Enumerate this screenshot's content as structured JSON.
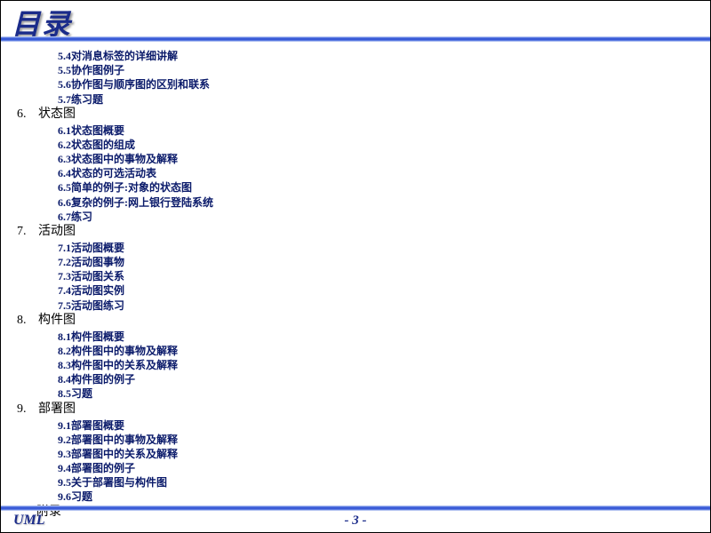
{
  "header": {
    "title": "目录"
  },
  "orphan_subs": [
    "5.4对消息标签的详细讲解",
    "5.5协作图例子",
    "5.6协作图与顺序图的区别和联系",
    "5.7练习题"
  ],
  "chapters": [
    {
      "num": "6.",
      "title": "状态图",
      "subs": [
        "6.1状态图概要",
        "6.2状态图的组成",
        "6.3状态图中的事物及解释",
        "6.4状态的可选活动表",
        "6.5简单的例子:对象的状态图",
        "6.6复杂的例子:网上银行登陆系统",
        "6.7练习"
      ]
    },
    {
      "num": "7.",
      "title": "活动图",
      "subs": [
        "7.1活动图概要",
        "7.2活动图事物",
        "7.3活动图关系",
        "7.4活动图实例",
        "7.5活动图练习"
      ]
    },
    {
      "num": "8.",
      "title": "构件图",
      "subs": [
        "8.1构件图概要",
        "8.2构件图中的事物及解释",
        "8.3构件图中的关系及解释",
        "8.4构件图的例子",
        "8.5习题"
      ]
    },
    {
      "num": "9.",
      "title": "部署图",
      "subs": [
        "9.1部署图概要",
        "9.2部署图中的事物及解释",
        "9.3部署图中的关系及解释",
        "9.4部署图的例子",
        "9.5关于部署图与构件图",
        "9.6习题"
      ]
    }
  ],
  "appendix": "附录",
  "footer": {
    "left": "UML",
    "page": "- 3 -"
  }
}
